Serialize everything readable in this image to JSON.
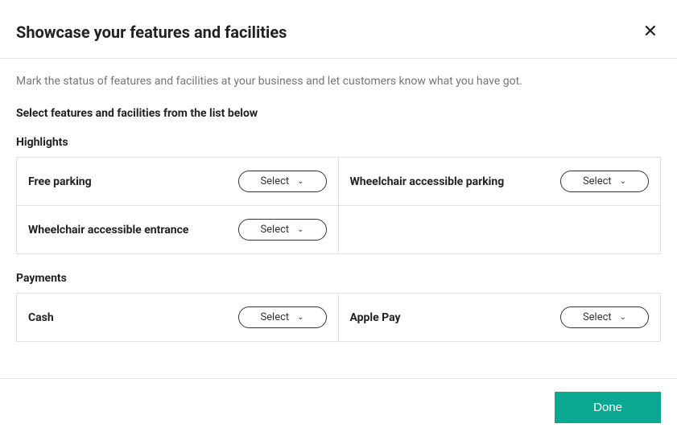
{
  "header": {
    "title": "Showcase your features and facilities",
    "close_label": "✕"
  },
  "body": {
    "description": "Mark the status of features and facilities at your business and let customers know what you have got.",
    "list_heading": "Select features and facilities from the list below"
  },
  "select_label": "Select",
  "sections": [
    {
      "title": "Highlights",
      "items": [
        {
          "label": "Free parking"
        },
        {
          "label": "Wheelchair accessible parking"
        },
        {
          "label": "Wheelchair accessible entrance"
        }
      ]
    },
    {
      "title": "Payments",
      "items": [
        {
          "label": "Cash"
        },
        {
          "label": "Apple Pay"
        }
      ]
    }
  ],
  "footer": {
    "done_label": "Done"
  }
}
